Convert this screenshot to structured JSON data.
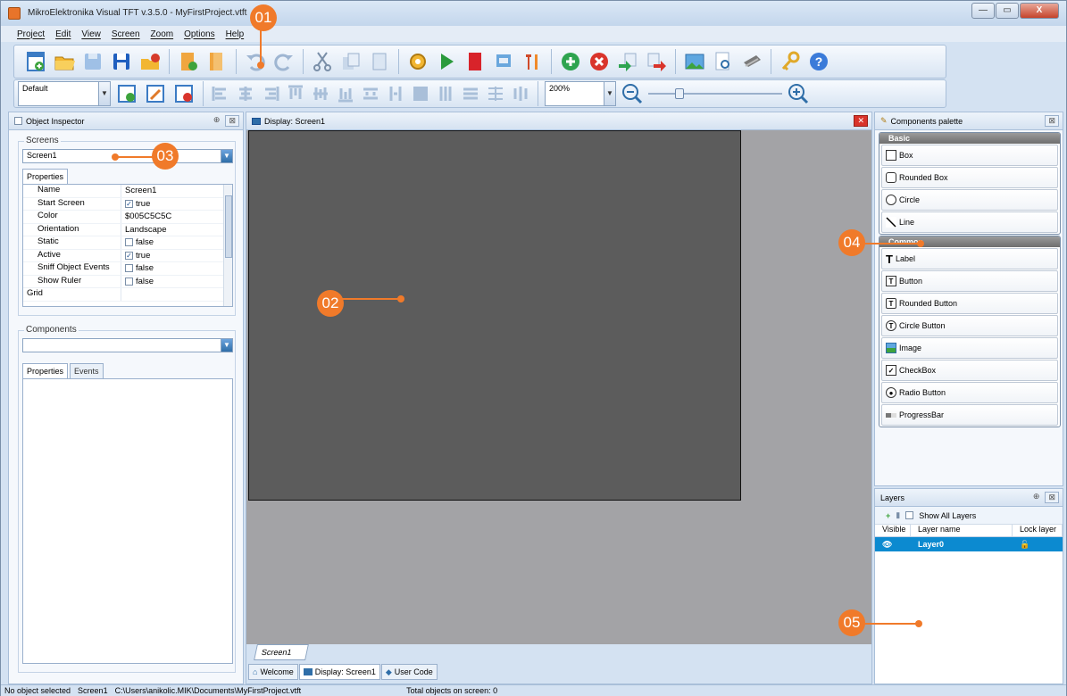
{
  "window": {
    "title": "MikroElektronika Visual TFT v.3.5.0 - MyFirstProject.vtft",
    "controls": {
      "minimize": "—",
      "maximize": "▭",
      "close": "X"
    }
  },
  "menu": [
    "Project",
    "Edit",
    "View",
    "Screen",
    "Zoom",
    "Options",
    "Help"
  ],
  "toolbar1": {
    "icons": [
      "new-project-icon",
      "open-icon",
      "save-disabled-icon",
      "save-icon",
      "close-project-icon",
      "add-screen-icon",
      "remove-screen-icon",
      "undo-icon",
      "redo-icon",
      "cut-icon",
      "copy-icon",
      "paste-icon",
      "build-icon",
      "run-icon",
      "sd-card-icon",
      "export-icon",
      "tools-icon",
      "add-icon",
      "delete-icon",
      "bring-forward-icon",
      "send-back-icon",
      "image-convert-icon",
      "preview-icon",
      "print-icon",
      "key-icon",
      "help-icon"
    ]
  },
  "toolbar2": {
    "style_value": "Default",
    "zoom_value": "200%"
  },
  "object_inspector": {
    "title": "Object Inspector",
    "pin": "⊕",
    "close": "⊠",
    "screens_label": "Screens",
    "screen_selected": "Screen1",
    "properties_tab": "Properties",
    "properties": [
      {
        "name": "Name",
        "value": "Screen1",
        "check": ""
      },
      {
        "name": "Start Screen",
        "value": "true",
        "check": "✓"
      },
      {
        "name": "Color",
        "value": "$005C5C5C",
        "check": ""
      },
      {
        "name": "Orientation",
        "value": "Landscape",
        "check": ""
      },
      {
        "name": "Static",
        "value": "false",
        "check": " "
      },
      {
        "name": "Active",
        "value": "true",
        "check": "✓"
      },
      {
        "name": "Sniff Object Events",
        "value": "false",
        "check": " "
      },
      {
        "name": "Show Ruler",
        "value": "false",
        "check": " "
      },
      {
        "name": "Grid",
        "value": "",
        "check": ""
      }
    ],
    "components_label": "Components",
    "components_selected": "",
    "comp_tabs": [
      "Properties",
      "Events"
    ]
  },
  "display": {
    "title": "Display: Screen1",
    "screen_tab": "Screen1",
    "canvas_color": "#5c5c5c",
    "bottom_tabs": [
      "Welcome",
      "Display: Screen1",
      "User Code"
    ]
  },
  "palette": {
    "title": "Components palette",
    "basic_header": "Basic",
    "basic_items": [
      "Box",
      "Rounded Box",
      "Circle",
      "Line"
    ],
    "common_header": "Common",
    "common_items": [
      "Label",
      "Button",
      "Rounded Button",
      "Circle Button",
      "Image",
      "CheckBox",
      "Radio Button",
      "ProgressBar"
    ]
  },
  "layers": {
    "title": "Layers",
    "show_all": "Show All Layers",
    "columns": [
      "Visible",
      "Layer name",
      "Lock layer"
    ],
    "rows": [
      {
        "name": "Layer0"
      }
    ]
  },
  "status": {
    "selection": "No object selected",
    "screen": "Screen1",
    "path": "C:\\Users\\anikolic.MIK\\Documents\\MyFirstProject.vtft",
    "objects": "Total objects on screen: 0"
  },
  "callouts": [
    "01",
    "02",
    "03",
    "04",
    "05"
  ],
  "colors": {
    "accent": "#f07a2a",
    "selection": "#0c8ad0",
    "canvas": "#5c5c5c"
  }
}
